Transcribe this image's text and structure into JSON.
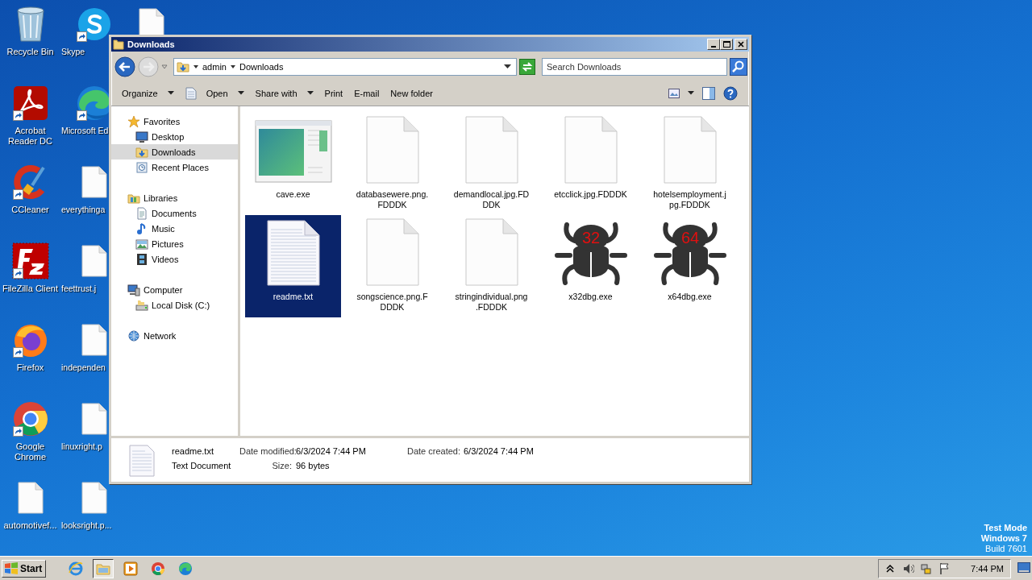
{
  "desktop": {
    "icons": [
      {
        "label": "Recycle Bin",
        "kind": "trash",
        "shortcut": false
      },
      {
        "label": "Acrobat Reader DC",
        "kind": "acrobat",
        "shortcut": true
      },
      {
        "label": "CCleaner",
        "kind": "ccleaner",
        "shortcut": true
      },
      {
        "label": "FileZilla Client",
        "kind": "filezilla",
        "shortcut": true
      },
      {
        "label": "Firefox",
        "kind": "firefox",
        "shortcut": true
      },
      {
        "label": "Google Chrome",
        "kind": "chrome",
        "shortcut": true
      },
      {
        "label": "automotivef...",
        "kind": "file",
        "shortcut": false
      },
      {
        "label": "Skype",
        "kind": "skype",
        "shortcut": true
      },
      {
        "label": "Microsoft Ed",
        "kind": "edge",
        "shortcut": true
      },
      {
        "label": "everythinga",
        "kind": "file",
        "shortcut": false
      },
      {
        "label": "feettrust.j",
        "kind": "file",
        "shortcut": false
      },
      {
        "label": "independen",
        "kind": "file",
        "shortcut": false
      },
      {
        "label": "linuxright.p",
        "kind": "file",
        "shortcut": false
      },
      {
        "label": "looksright.p...",
        "kind": "file",
        "shortcut": false
      },
      {
        "kind": "file",
        "shortcut": false
      }
    ]
  },
  "window": {
    "title": "Downloads",
    "address": {
      "breadcrumbs": [
        "admin",
        "Downloads"
      ]
    },
    "search": {
      "placeholder": "Search Downloads"
    },
    "toolbar": [
      {
        "label": "Organize",
        "kind": "menu"
      },
      {
        "label": "Open",
        "kind": "openmenu"
      },
      {
        "label": "Share with",
        "kind": "menu"
      },
      {
        "label": "Print",
        "kind": "action"
      },
      {
        "label": "E-mail",
        "kind": "action"
      },
      {
        "label": "New folder",
        "kind": "action"
      }
    ],
    "sidebar": {
      "items": [
        {
          "label": "Favorites",
          "kind": "star",
          "selected": false,
          "children": [
            {
              "label": "Desktop",
              "kind": "desktop",
              "selected": false
            },
            {
              "label": "Downloads",
              "kind": "downloads",
              "selected": true
            },
            {
              "label": "Recent Places",
              "kind": "recent",
              "selected": false
            }
          ]
        },
        {
          "label": "Libraries",
          "kind": "library",
          "selected": false,
          "children": [
            {
              "label": "Documents",
              "kind": "documents",
              "selected": false
            },
            {
              "label": "Music",
              "kind": "music",
              "selected": false
            },
            {
              "label": "Pictures",
              "kind": "pictures",
              "selected": false
            },
            {
              "label": "Videos",
              "kind": "videos",
              "selected": false
            }
          ]
        },
        {
          "label": "Computer",
          "kind": "computer",
          "selected": false,
          "children": [
            {
              "label": "Local Disk (C:)",
              "kind": "disk",
              "selected": false
            }
          ]
        },
        {
          "label": "Network",
          "kind": "network",
          "selected": false
        }
      ]
    },
    "files": [
      {
        "name": "cave.exe",
        "kind": "program",
        "selected": false
      },
      {
        "name": "databasewere.png.\nFDDDK",
        "kind": "blank",
        "selected": false
      },
      {
        "name": "demandlocal.jpg.FD\nDDK",
        "kind": "blank",
        "selected": false
      },
      {
        "name": "etcclick.jpg.FDDDK",
        "kind": "blank",
        "selected": false
      },
      {
        "name": "hotelsemployment.j\npg.FDDDK",
        "kind": "blank",
        "selected": false
      },
      {
        "name": "readme.txt",
        "kind": "text",
        "selected": true
      },
      {
        "name": "songscience.png.F\nDDDK",
        "kind": "blank",
        "selected": false
      },
      {
        "name": "stringindividual.png\n.FDDDK",
        "kind": "blank",
        "selected": false
      },
      {
        "name": "x32dbg.exe",
        "kind": "bug",
        "badge": "32",
        "selected": false
      },
      {
        "name": "x64dbg.exe",
        "kind": "bug",
        "badge": "64",
        "selected": false
      }
    ],
    "details": {
      "name": "readme.txt",
      "type": "Text Document",
      "fields": [
        {
          "label": "Date modified:",
          "value": "6/3/2024 7:44 PM"
        },
        {
          "label": "Date created:",
          "value": "6/3/2024 7:44 PM"
        },
        {
          "label": "Size:",
          "value": "96 bytes"
        }
      ]
    }
  },
  "taskbar": {
    "start": "Start",
    "apps": [
      {
        "kind": "ie",
        "selected": false
      },
      {
        "kind": "explorer",
        "selected": true
      },
      {
        "kind": "media",
        "selected": false
      },
      {
        "kind": "chrome",
        "selected": false
      },
      {
        "kind": "edge",
        "selected": false
      }
    ],
    "clock": "7:44 PM"
  },
  "watermark_text": [
    "Test Mode",
    "Windows 7",
    "Build 7601"
  ]
}
